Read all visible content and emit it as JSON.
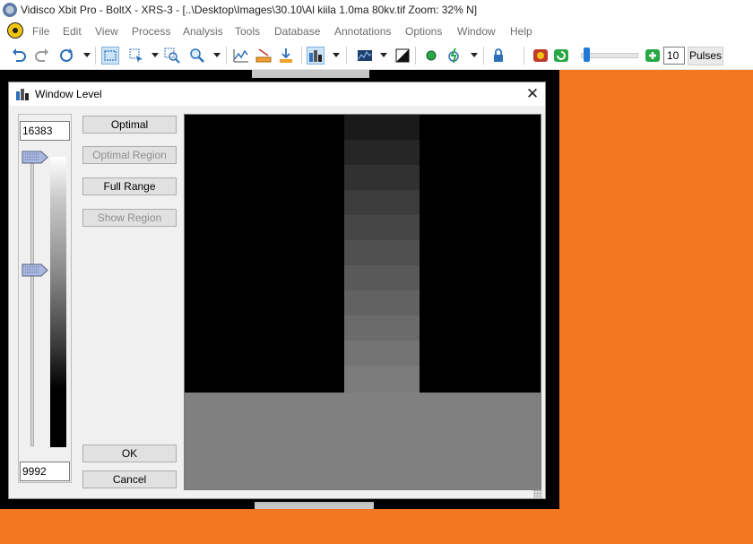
{
  "window": {
    "title": "Vidisco Xbit Pro - BoltX - XRS-3 - [..\\Desktop\\Images\\30.10\\Al kiila 1.0ma 80kv.tif  Zoom: 32% N]"
  },
  "menu": {
    "items": [
      "File",
      "Edit",
      "View",
      "Process",
      "Analysis",
      "Tools",
      "Database",
      "Annotations",
      "Options",
      "Window",
      "Help"
    ]
  },
  "toolbar": {
    "icons": [
      "undo-icon",
      "redo-icon",
      "refresh-icon",
      "rectangle-select-icon",
      "region-select-icon",
      "zoom-region-icon",
      "zoom-icon",
      "line-profile-icon",
      "measure-icon",
      "calibrate-icon",
      "window-level-icon",
      "histogram-icon",
      "invert-icon",
      "xray-source-icon",
      "flash-icon",
      "lock-icon",
      "capture-icon",
      "refresh-green-icon",
      "add-green-icon"
    ],
    "pulses_value": "10",
    "pulses_label": "Pulses"
  },
  "dialog": {
    "title": "Window Level",
    "close_glyph": "✕",
    "high_value": "16383",
    "low_value": "9992",
    "buttons": {
      "optimal": "Optimal",
      "optimal_region": "Optimal Region",
      "full_range": "Full Range",
      "show_region": "Show Region",
      "ok": "OK",
      "cancel": "Cancel"
    }
  },
  "colors": {
    "workspace_orange": "#f37720",
    "dialog_bg": "#f0f0f0"
  }
}
